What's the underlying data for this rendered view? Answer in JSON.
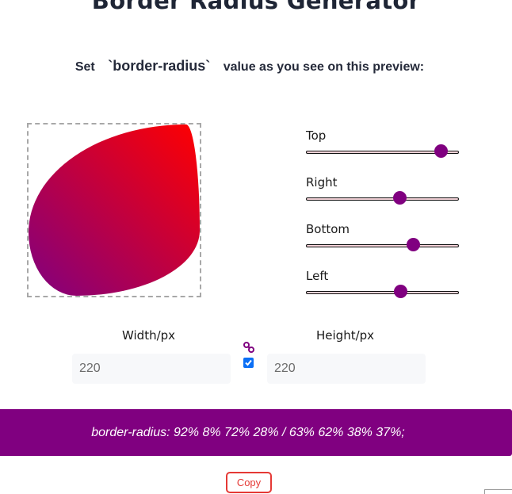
{
  "header": {
    "title": "Border Radius Generator",
    "subtitle_prefix": "Set",
    "subtitle_code": "`border-radius`",
    "subtitle_suffix": "value as you see on this preview:"
  },
  "preview": {
    "gradient_from": "#800080",
    "gradient_to": "#ff0000"
  },
  "sliders": [
    {
      "label": "Top",
      "value_percent": 92
    },
    {
      "label": "Right",
      "value_percent": 62
    },
    {
      "label": "Bottom",
      "value_percent": 72
    },
    {
      "label": "Left",
      "value_percent": 63
    }
  ],
  "dimensions": {
    "width_label": "Width/px",
    "width_value": "220",
    "height_label": "Height/px",
    "height_value": "220",
    "link_checked": true,
    "link_icon": "link-icon"
  },
  "output": {
    "css_text": "border-radius: 92% 8% 72% 28% / 63% 62% 38% 37%;",
    "bar_color": "#800080"
  },
  "actions": {
    "copy_label": "Copy"
  }
}
